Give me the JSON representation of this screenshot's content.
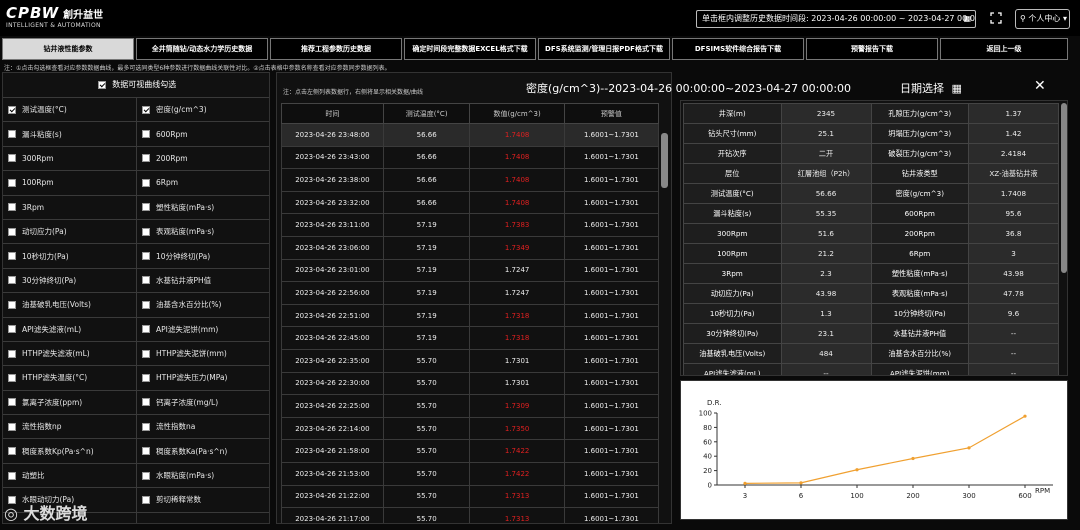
{
  "header": {
    "brand": "CPBW",
    "brand_cn": "創升益世",
    "brand_sub": "INTELLIGENT & AUTOMATION",
    "range_label": "单击框内调整历史数据时间段:",
    "range_value": "2023-04-26 00:00:00 ~ 2023-04-27 00:00:00",
    "user_label": "个人中心"
  },
  "tabs": [
    {
      "label": "钻井液性能参数",
      "active": true
    },
    {
      "label": "全井筒随钻/动态水力学历史数据"
    },
    {
      "label": "推荐工程参数历史数据"
    },
    {
      "label": "确定时间段完整数据EXCEL格式下载"
    },
    {
      "label": "DFS系统监测/管理日报PDF格式下载"
    },
    {
      "label": "DFSIMS软件综合报告下载"
    },
    {
      "label": "预警报告下载"
    },
    {
      "label": "返回上一级"
    }
  ],
  "note": "注：①点击勾选框查看对应参数数据曲线，最多可选同类型6种参数进行数据曲线关联性对比。②点击表格中参数名称查看对应参数同步数据列表。",
  "left": {
    "title": "数据可视曲线勾选",
    "options": [
      [
        "测试温度(°C)",
        "密度(g/cm^3)"
      ],
      [
        "漏斗粘度(s)",
        "600Rpm"
      ],
      [
        "300Rpm",
        "200Rpm"
      ],
      [
        "100Rpm",
        "6Rpm"
      ],
      [
        "3Rpm",
        "塑性粘度(mPa·s)"
      ],
      [
        "动切应力(Pa)",
        "表观粘度(mPa·s)"
      ],
      [
        "10秒切力(Pa)",
        "10分钟终切(Pa)"
      ],
      [
        "30分钟终切(Pa)",
        "水基钻井液PH值"
      ],
      [
        "油基破乳电压(Volts)",
        "油基含水百分比(%)"
      ],
      [
        "API滤失滤液(mL)",
        "API滤失泥饼(mm)"
      ],
      [
        "HTHP滤失滤液(mL)",
        "HTHP滤失泥饼(mm)"
      ],
      [
        "HTHP滤失温度(°C)",
        "HTHP滤失压力(MPa)"
      ],
      [
        "氯离子浓度(ppm)",
        "钙离子浓度(mg/L)"
      ],
      [
        "流性指数np",
        "流性指数na"
      ],
      [
        "稠度系数Kp(Pa·s^n)",
        "稠度系数Ka(Pa·s^n)"
      ],
      [
        "动塑比",
        "水眼粘度(mPa·s)"
      ],
      [
        "水眼动切力(Pa)",
        "剪切稀释常数"
      ],
      [
        "",
        ""
      ]
    ],
    "checked": [
      [
        true,
        true
      ]
    ]
  },
  "middle": {
    "title": "密度(g/cm^3)--2023-04-26 00:00:00~2023-04-27 00:00:00",
    "note": "注：点击左侧列表数据行，右侧将显示相关数据/曲线",
    "headers": [
      "时间",
      "测试温度(°C)",
      "数值(g/cm^3)",
      "预警值"
    ],
    "rows": [
      [
        "2023-04-26 23:48:00",
        "56.66",
        "1.7408",
        "1.6001~1.7301",
        true
      ],
      [
        "2023-04-26 23:43:00",
        "56.66",
        "1.7408",
        "1.6001~1.7301",
        true
      ],
      [
        "2023-04-26 23:38:00",
        "56.66",
        "1.7408",
        "1.6001~1.7301",
        true
      ],
      [
        "2023-04-26 23:32:00",
        "56.66",
        "1.7408",
        "1.6001~1.7301",
        true
      ],
      [
        "2023-04-26 23:11:00",
        "57.19",
        "1.7383",
        "1.6001~1.7301",
        true
      ],
      [
        "2023-04-26 23:06:00",
        "57.19",
        "1.7349",
        "1.6001~1.7301",
        true
      ],
      [
        "2023-04-26 23:01:00",
        "57.19",
        "1.7247",
        "1.6001~1.7301",
        false
      ],
      [
        "2023-04-26 22:56:00",
        "57.19",
        "1.7247",
        "1.6001~1.7301",
        false
      ],
      [
        "2023-04-26 22:51:00",
        "57.19",
        "1.7318",
        "1.6001~1.7301",
        true
      ],
      [
        "2023-04-26 22:45:00",
        "57.19",
        "1.7318",
        "1.6001~1.7301",
        true
      ],
      [
        "2023-04-26 22:35:00",
        "55.70",
        "1.7301",
        "1.6001~1.7301",
        false
      ],
      [
        "2023-04-26 22:30:00",
        "55.70",
        "1.7301",
        "1.6001~1.7301",
        false
      ],
      [
        "2023-04-26 22:25:00",
        "55.70",
        "1.7309",
        "1.6001~1.7301",
        true
      ],
      [
        "2023-04-26 22:14:00",
        "55.70",
        "1.7350",
        "1.6001~1.7301",
        true
      ],
      [
        "2023-04-26 21:58:00",
        "55.70",
        "1.7422",
        "1.6001~1.7301",
        true
      ],
      [
        "2023-04-26 21:53:00",
        "55.70",
        "1.7422",
        "1.6001~1.7301",
        true
      ],
      [
        "2023-04-26 21:22:00",
        "55.70",
        "1.7313",
        "1.6001~1.7301",
        true
      ],
      [
        "2023-04-26 21:17:00",
        "55.70",
        "1.7313",
        "1.6001~1.7301",
        true
      ]
    ]
  },
  "right": {
    "date_pick": "日期选择",
    "rows": [
      [
        "井深(m)",
        "2345",
        "孔隙压力(g/cm^3)",
        "1.37"
      ],
      [
        "钻头尺寸(mm)",
        "25.1",
        "坍塌压力(g/cm^3)",
        "1.42"
      ],
      [
        "开钻次序",
        "二开",
        "破裂压力(g/cm^3)",
        "2.4184"
      ],
      [
        "层位",
        "红層池组（P2h）",
        "钻井液类型",
        "XZ-油基钻井液"
      ],
      [
        "测试温度(°C)",
        "56.66",
        "密度(g/cm^3)",
        "1.7408"
      ],
      [
        "漏斗粘度(s)",
        "55.35",
        "600Rpm",
        "95.6"
      ],
      [
        "300Rpm",
        "51.6",
        "200Rpm",
        "36.8"
      ],
      [
        "100Rpm",
        "21.2",
        "6Rpm",
        "3"
      ],
      [
        "3Rpm",
        "2.3",
        "塑性粘度(mPa·s)",
        "43.98"
      ],
      [
        "动切应力(Pa)",
        "43.98",
        "表观粘度(mPa·s)",
        "47.78"
      ],
      [
        "10秒切力(Pa)",
        "1.3",
        "10分钟终切(Pa)",
        "9.6"
      ],
      [
        "30分钟终切(Pa)",
        "23.1",
        "水基钻井液PH值",
        "--"
      ],
      [
        "油基破乳电压(Volts)",
        "484",
        "油基含水百分比(%)",
        "--"
      ],
      [
        "API滤失滤液(mL)",
        "--",
        "API滤失泥饼(mm)",
        "--"
      ]
    ]
  },
  "chart_data": {
    "type": "line",
    "categories": [
      "3",
      "6",
      "100",
      "200",
      "300",
      "600"
    ],
    "series": [
      {
        "values": [
          2.3,
          3,
          21.2,
          36.8,
          51.6,
          95.6
        ]
      }
    ],
    "ylabel": "D.R.",
    "xlabel": "RPM",
    "ylim": [
      0,
      100
    ],
    "yticks": [
      "0",
      "20",
      "40",
      "60",
      "80",
      "100"
    ],
    "line_color": "#f0a030",
    "grid": false
  },
  "watermark": "大数跨境"
}
